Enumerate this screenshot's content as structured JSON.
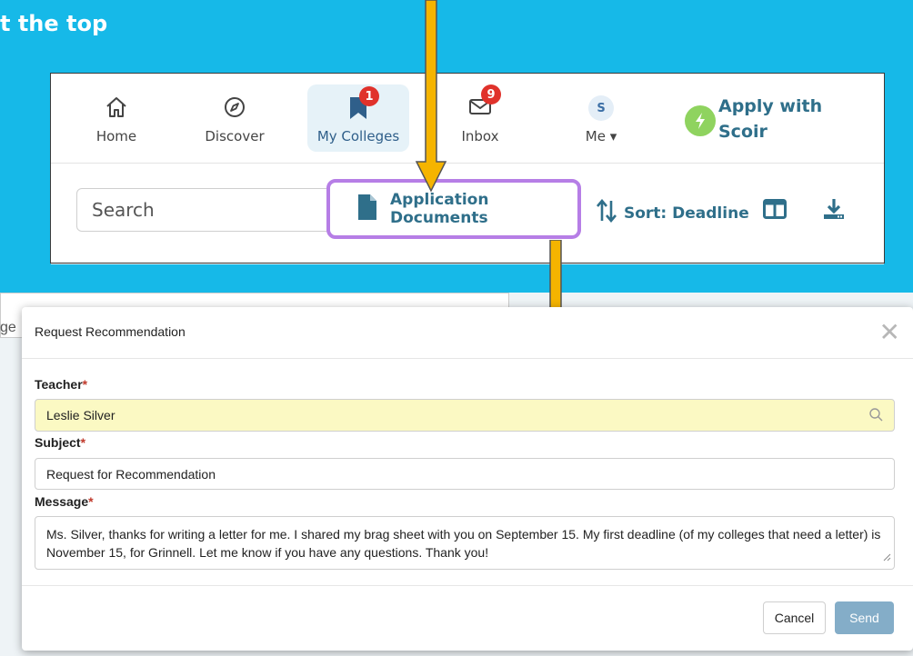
{
  "heading": "t the top",
  "nav": {
    "items": [
      {
        "label": "Home",
        "icon": "home-icon"
      },
      {
        "label": "Discover",
        "icon": "compass-icon"
      },
      {
        "label": "My Colleges",
        "icon": "bookmark-icon",
        "badge": "1"
      },
      {
        "label": "Inbox",
        "icon": "mail-icon",
        "badge": "9"
      },
      {
        "label": "Me ▾",
        "avatar_letter": "S"
      }
    ],
    "apply_label": "Apply with Scoir"
  },
  "toolbar": {
    "search_placeholder": "Search",
    "app_docs_label": "Application Documents",
    "sort_label": "Sort: Deadline"
  },
  "background_peek": "ge",
  "modal": {
    "title": "Request Recommendation",
    "teacher_label": "Teacher",
    "teacher_value": "Leslie Silver",
    "subject_label": "Subject",
    "subject_value": "Request for Recommendation",
    "message_label": "Message",
    "message_value": "Ms. Silver, thanks for writing a letter for me. I shared my brag sheet with you on September 15. My first deadline (of my colleges that need a letter) is November 15, for Grinnell. Let me know if you have any questions. Thank you!",
    "required_mark": "*",
    "cancel_label": "Cancel",
    "send_label": "Send"
  },
  "colors": {
    "background": "#16b9e8",
    "accent": "#2f6f8a",
    "highlight_border": "#b67ee6",
    "arrow": "#f5b400",
    "badge": "#e0322b"
  }
}
